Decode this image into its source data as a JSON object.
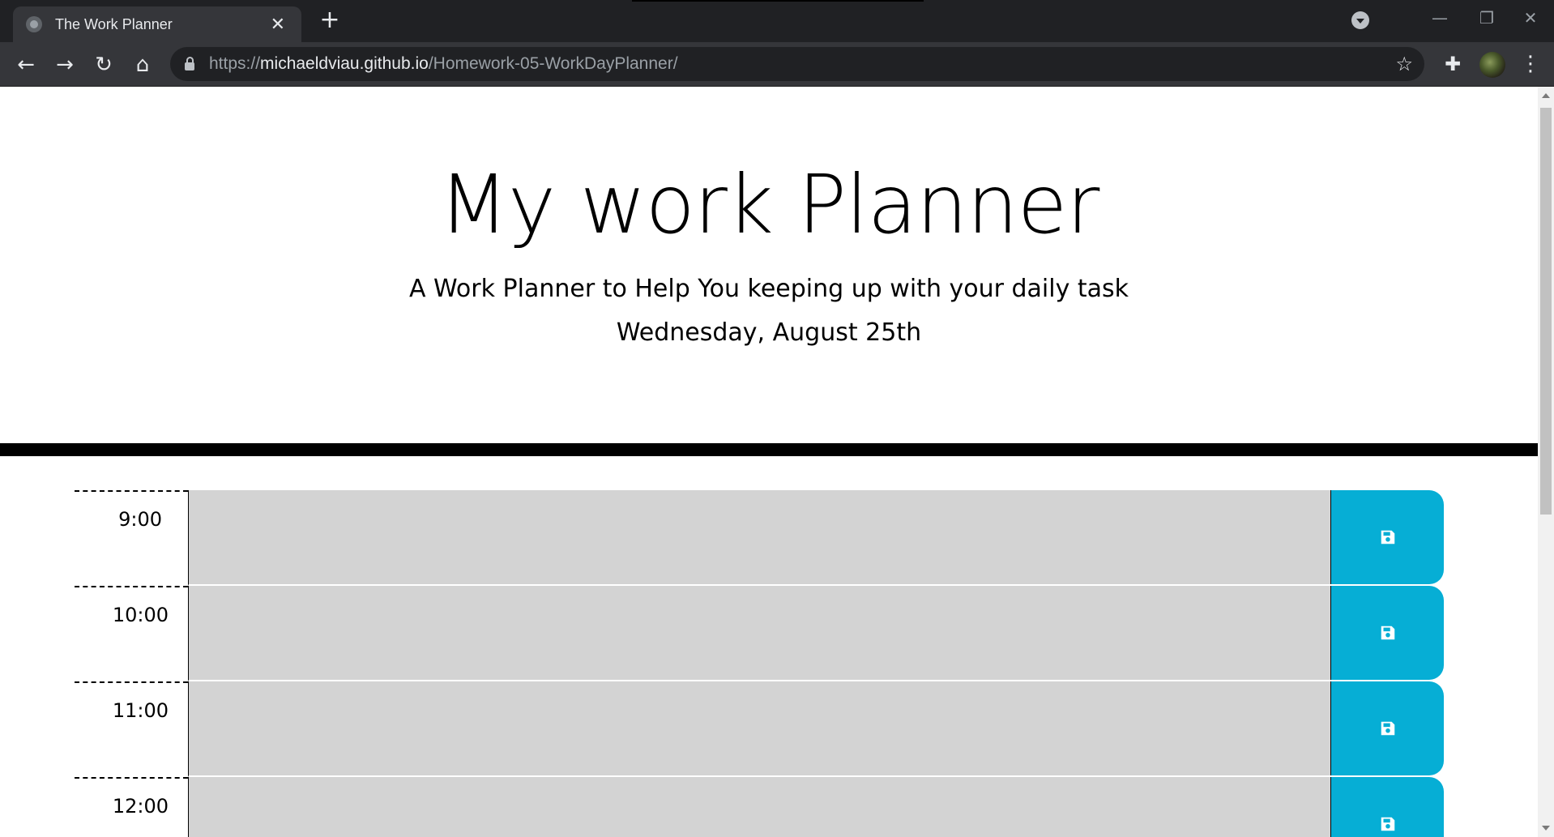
{
  "browser": {
    "tab_title": "The Work Planner",
    "tab_close": "✕",
    "new_tab": "+",
    "url_scheme": "https://",
    "url_host": "michaeldviau.github.io",
    "url_path": "/Homework-05-WorkDayPlanner/",
    "star": "☆",
    "extensions": "✚",
    "menu": "⋮",
    "back": "←",
    "forward": "→",
    "reload": "↻",
    "home": "⌂",
    "minimize": "—",
    "restore": "❐",
    "close": "✕"
  },
  "header": {
    "title": "My work Planner",
    "subtitle": "A Work Planner to Help You keeping up with your daily task",
    "date": "Wednesday, August 25th"
  },
  "planner": {
    "rows": [
      {
        "hour": "9:00",
        "task": ""
      },
      {
        "hour": "10:00",
        "task": ""
      },
      {
        "hour": "11:00",
        "task": ""
      },
      {
        "hour": "12:00",
        "task": ""
      }
    ]
  },
  "colors": {
    "save_button": "#06aed5",
    "task_past": "#d3d3d3"
  }
}
